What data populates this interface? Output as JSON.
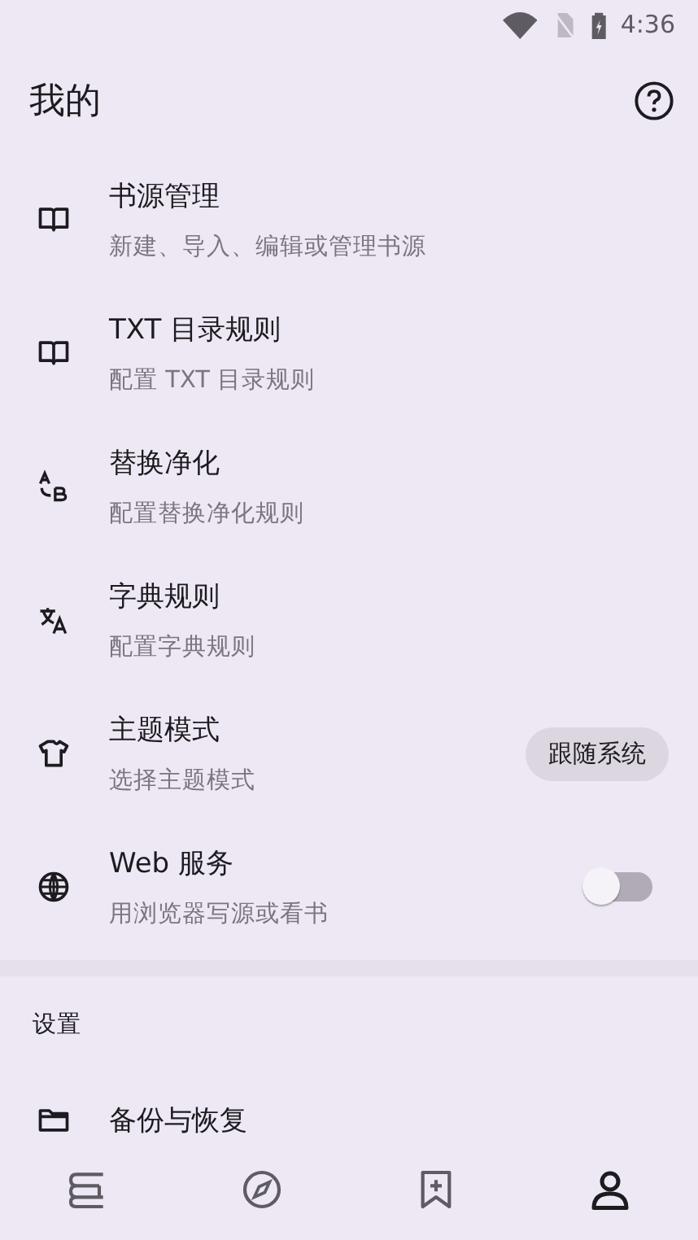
{
  "status_bar": {
    "time": "4:36"
  },
  "header": {
    "title": "我的"
  },
  "items": [
    {
      "kind": "plain",
      "title": "书源管理",
      "subtitle": "新建、导入、编辑或管理书源"
    },
    {
      "kind": "plain",
      "title": "TXT 目录规则",
      "subtitle": "配置 TXT 目录规则"
    },
    {
      "kind": "plain",
      "title": "替换净化",
      "subtitle": "配置替换净化规则"
    },
    {
      "kind": "plain",
      "title": "字典规则",
      "subtitle": "配置字典规则"
    },
    {
      "kind": "chip",
      "title": "主题模式",
      "subtitle": "选择主题模式",
      "value": "跟随系统"
    },
    {
      "kind": "switch",
      "title": "Web 服务",
      "subtitle": "用浏览器写源或看书",
      "on": false
    }
  ],
  "section": {
    "title": "设置",
    "items": [
      {
        "title": "备份与恢复"
      }
    ]
  },
  "nav": [
    {
      "selected": false
    },
    {
      "selected": false
    },
    {
      "selected": false
    },
    {
      "selected": true
    }
  ]
}
